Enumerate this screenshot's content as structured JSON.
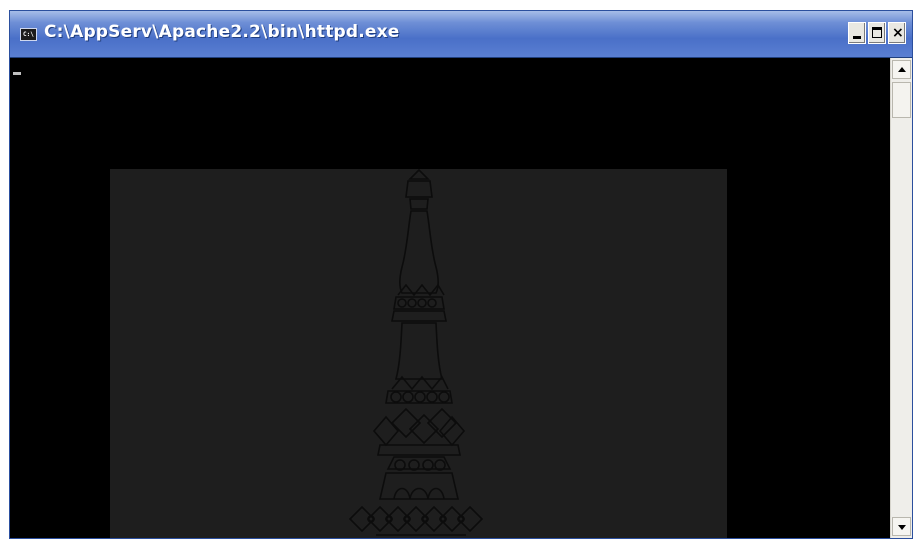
{
  "window": {
    "title": "C:\\AppServ\\Apache2.2\\bin\\httpd.exe",
    "title_icon_label": "C:\\",
    "controls": {
      "minimize": "minimize-icon",
      "maximize": "maximize-icon",
      "close": "close-icon"
    }
  },
  "console": {
    "background": "#000000",
    "cursor_color": "#c0c0c0",
    "overlay_background": "#1e1e1e",
    "overlay_graphic": "tower-outline-icon"
  },
  "scrollbar": {
    "up": "scroll-up-arrow-icon",
    "down": "scroll-down-arrow-icon"
  },
  "colors": {
    "titlebar": "#4a70c8",
    "title_text": "#ffffff",
    "tower_stroke": "#0c0c0c"
  }
}
